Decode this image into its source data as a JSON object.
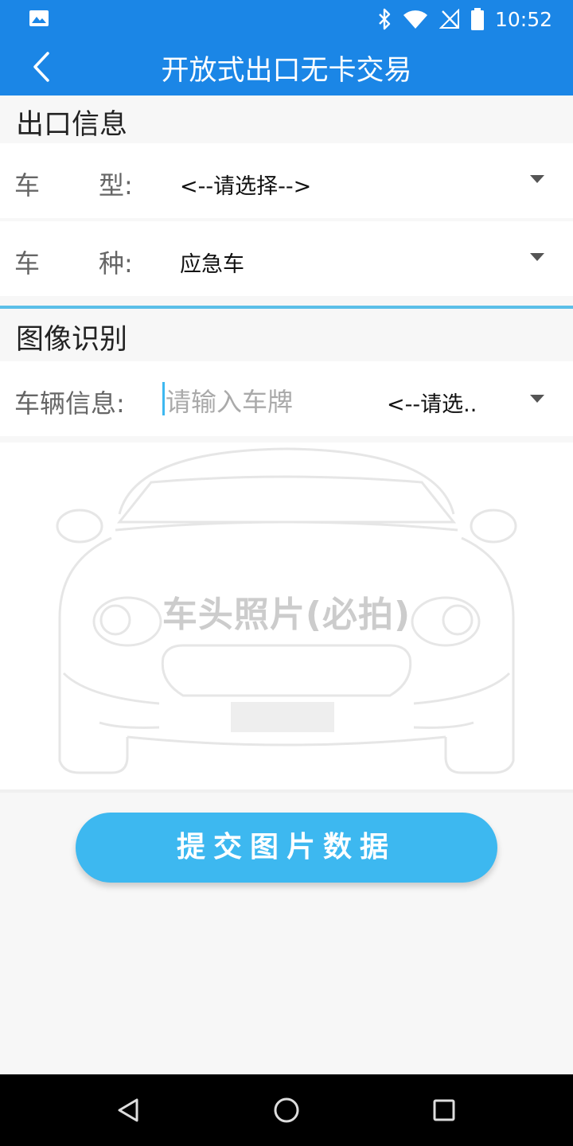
{
  "status_bar": {
    "time": "10:52"
  },
  "app_bar": {
    "title": "开放式出口无卡交易"
  },
  "exit_info": {
    "heading": "出口信息",
    "vehicle_type": {
      "label_a": "车",
      "label_b": "型:",
      "value": "<--请选择-->"
    },
    "vehicle_kind": {
      "label_a": "车",
      "label_b": "种:",
      "value": "应急车"
    }
  },
  "image_recognition": {
    "heading": "图像识别",
    "vehicle_info": {
      "label": "车辆信息:",
      "placeholder": "请输入车牌",
      "select_value": "<--请选.."
    }
  },
  "photo": {
    "caption": "车头照片(必拍)"
  },
  "submit_label": "提交图片数据",
  "colors": {
    "primary": "#1b86e6",
    "accent": "#3db8f0",
    "divider": "#5bbfe8"
  }
}
